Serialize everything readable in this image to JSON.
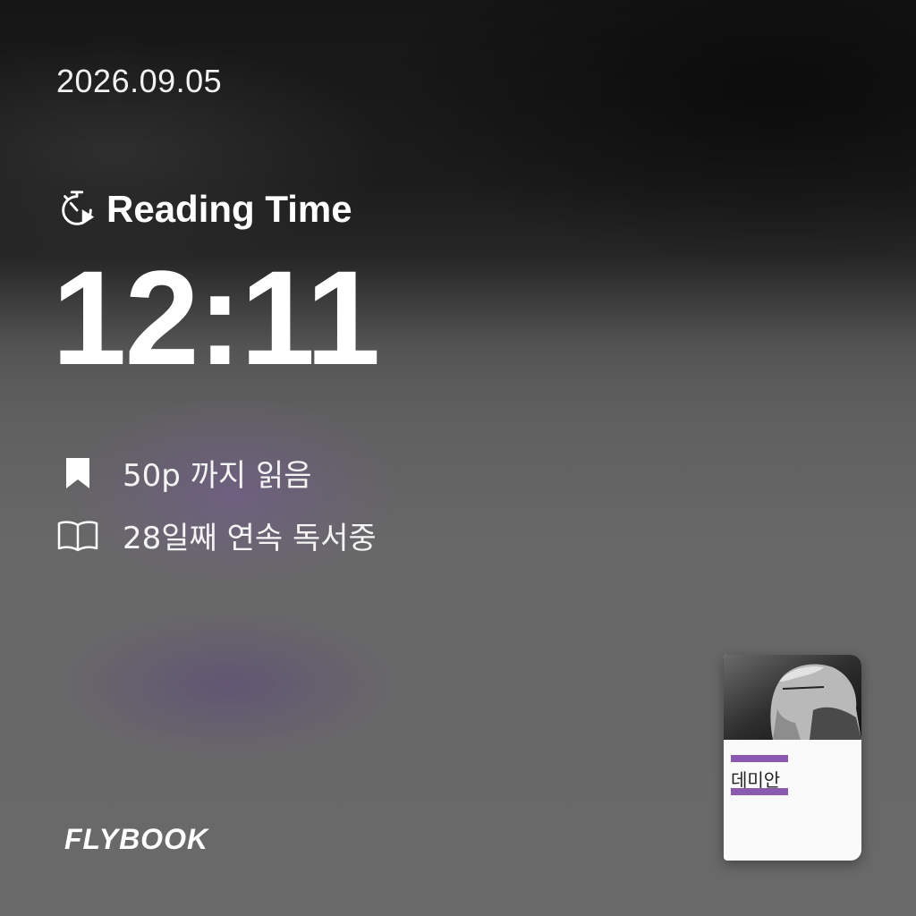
{
  "date": "2026.09.05",
  "reading": {
    "label": "Reading Time",
    "icon": "stopwatch-play-icon",
    "time": "12:11"
  },
  "stats": [
    {
      "icon": "bookmark-icon",
      "text": "50p 까지 읽음"
    },
    {
      "icon": "open-book-icon",
      "text": "28일째 연속 독서중"
    }
  ],
  "brand": {
    "logo": "FLYBOOK"
  },
  "book": {
    "title": "데미안",
    "cover_colors": {
      "accent": "#8a5ab0",
      "paper": "#fafafa"
    }
  }
}
